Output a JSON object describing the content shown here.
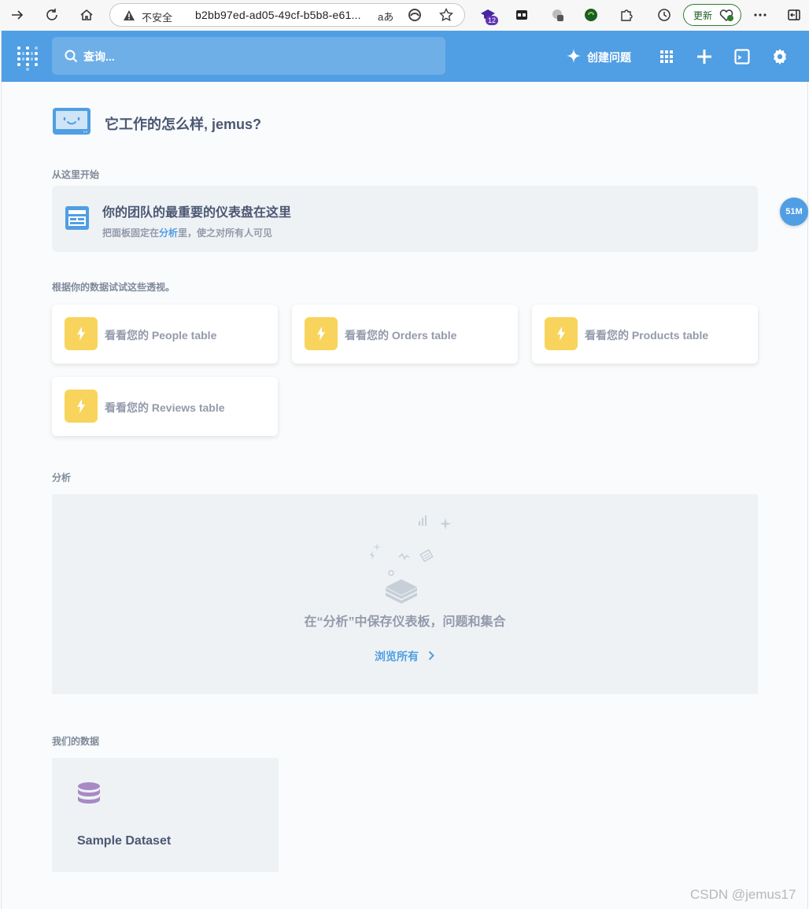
{
  "browser": {
    "security_label": "不安全",
    "url": "b2bb97ed-ad05-49cf-b5b8-e61...",
    "read_aloud": "aあ",
    "extension_badge": "12",
    "update_label": "更新"
  },
  "header": {
    "search_placeholder": "查询...",
    "new_question_label": "创建问题",
    "brand_color": "#509ee3"
  },
  "greeting": "它工作的怎么样, jemus?",
  "start_here": {
    "section_title": "从这里开始",
    "pin_title": "你的团队的最重要的仪表盘在这里",
    "pin_sub_before": "把面板固定在",
    "pin_sub_link": "分析",
    "pin_sub_after": "里，使之对所有人可见"
  },
  "floating_badge": "51M",
  "xrays": {
    "section_title": "根据你的数据试试这些透视。",
    "items": [
      {
        "label": "看看您的 People table"
      },
      {
        "label": "看看您的 Orders table"
      },
      {
        "label": "看看您的 Products table"
      },
      {
        "label": "看看您的 Reviews table"
      }
    ],
    "accent": "#f9d45c"
  },
  "analysis": {
    "section_title": "分析",
    "empty_message": "在“分析”中保存仪表板，问题和集合",
    "browse_label": "浏览所有"
  },
  "our_data": {
    "section_title": "我们的数据",
    "dataset_name": "Sample Dataset",
    "icon_color": "#a989c5"
  },
  "watermark": "CSDN @jemus17"
}
